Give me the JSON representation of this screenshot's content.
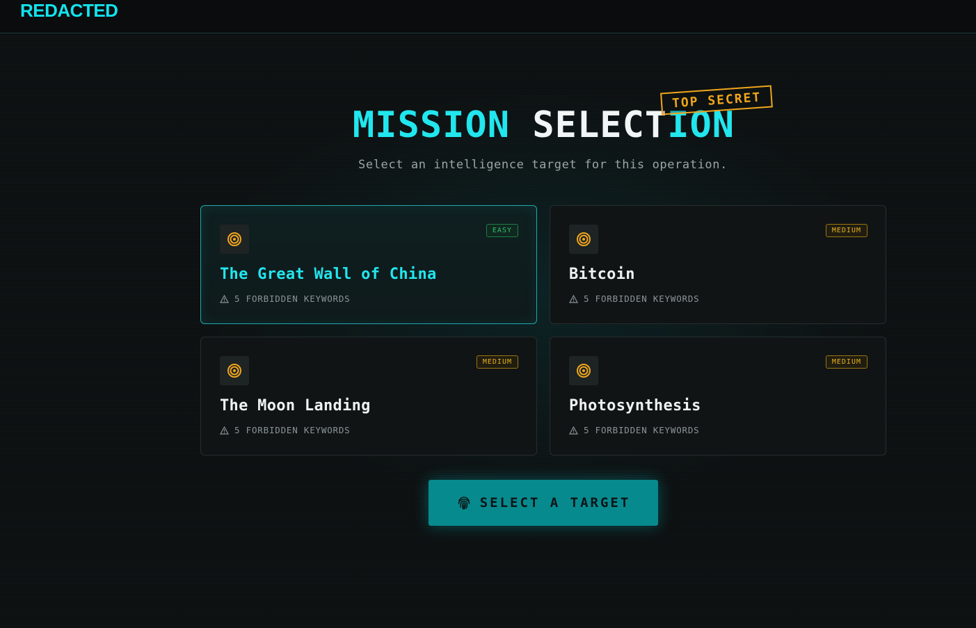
{
  "brand": "REDACTED",
  "title": {
    "part1": "MISSION",
    "part2": "SELECT",
    "part3": "ION"
  },
  "stamp": "TOP SECRET",
  "subtitle": "Select an intelligence target for this operation.",
  "missions": [
    {
      "title": "The Great Wall of China",
      "difficulty": "EASY",
      "keywords": "5 FORBIDDEN KEYWORDS",
      "selected": true
    },
    {
      "title": "Bitcoin",
      "difficulty": "MEDIUM",
      "keywords": "5 FORBIDDEN KEYWORDS",
      "selected": false
    },
    {
      "title": "The Moon Landing",
      "difficulty": "MEDIUM",
      "keywords": "5 FORBIDDEN KEYWORDS",
      "selected": false
    },
    {
      "title": "Photosynthesis",
      "difficulty": "MEDIUM",
      "keywords": "5 FORBIDDEN KEYWORDS",
      "selected": false
    }
  ],
  "button": {
    "label": "SELECT A TARGET",
    "icon": "fingerprint-icon"
  },
  "colors": {
    "accent": "#22e6ee",
    "stamp": "#f0a61c",
    "easy": "#2fc06a",
    "medium": "#e9b21e",
    "button": "#078a8e"
  }
}
